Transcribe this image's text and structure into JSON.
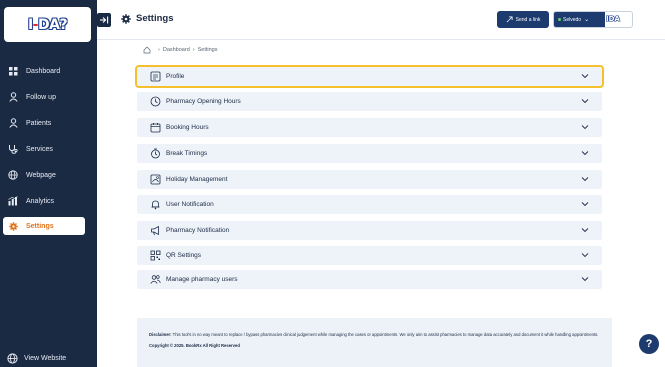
{
  "logo": {
    "text_left": "I",
    "dash": "-",
    "text_right": "DA",
    "mark": "?"
  },
  "sidebar": {
    "items": [
      {
        "label": "Dashboard",
        "icon": "dashboard-icon"
      },
      {
        "label": "Follow up",
        "icon": "user-icon"
      },
      {
        "label": "Patients",
        "icon": "user-icon"
      },
      {
        "label": "Services",
        "icon": "stethoscope-icon"
      },
      {
        "label": "Webpage",
        "icon": "globe-icon"
      },
      {
        "label": "Analytics",
        "icon": "analytics-icon"
      },
      {
        "label": "Settings",
        "icon": "gear-icon",
        "active": true
      }
    ],
    "view_website": "View Website"
  },
  "header": {
    "title": "Settings",
    "send_link": "Send a link",
    "account": "Selvedo",
    "account_logo": "IDA"
  },
  "breadcrumb": {
    "home": "Dashboard",
    "current": "Settings"
  },
  "sections": [
    {
      "label": "Profile"
    },
    {
      "label": "Pharmacy Opening Hours"
    },
    {
      "label": "Booking Hours"
    },
    {
      "label": "Break Timings"
    },
    {
      "label": "Holiday Management"
    },
    {
      "label": "User Notification"
    },
    {
      "label": "Pharmacy Notification"
    },
    {
      "label": "QR Settings"
    },
    {
      "label": "Manage pharmacy users"
    }
  ],
  "footer": {
    "disclaimer_label": "Disclaimer:",
    "disclaimer_text": " This tool's in no way meant to replace / bypass pharmacies clinical judgement while managing the cases or appointments. We only aim to assist pharmacies to manage data accurately and document it while handling appointments.",
    "copyright": "Copyright © 2025. BookRx All Right Reserved"
  },
  "help": "?",
  "colors": {
    "sidebar": "#1b2a43",
    "accent": "#e2721b",
    "highlight": "#f4c02d",
    "primary": "#1d3b6f"
  }
}
